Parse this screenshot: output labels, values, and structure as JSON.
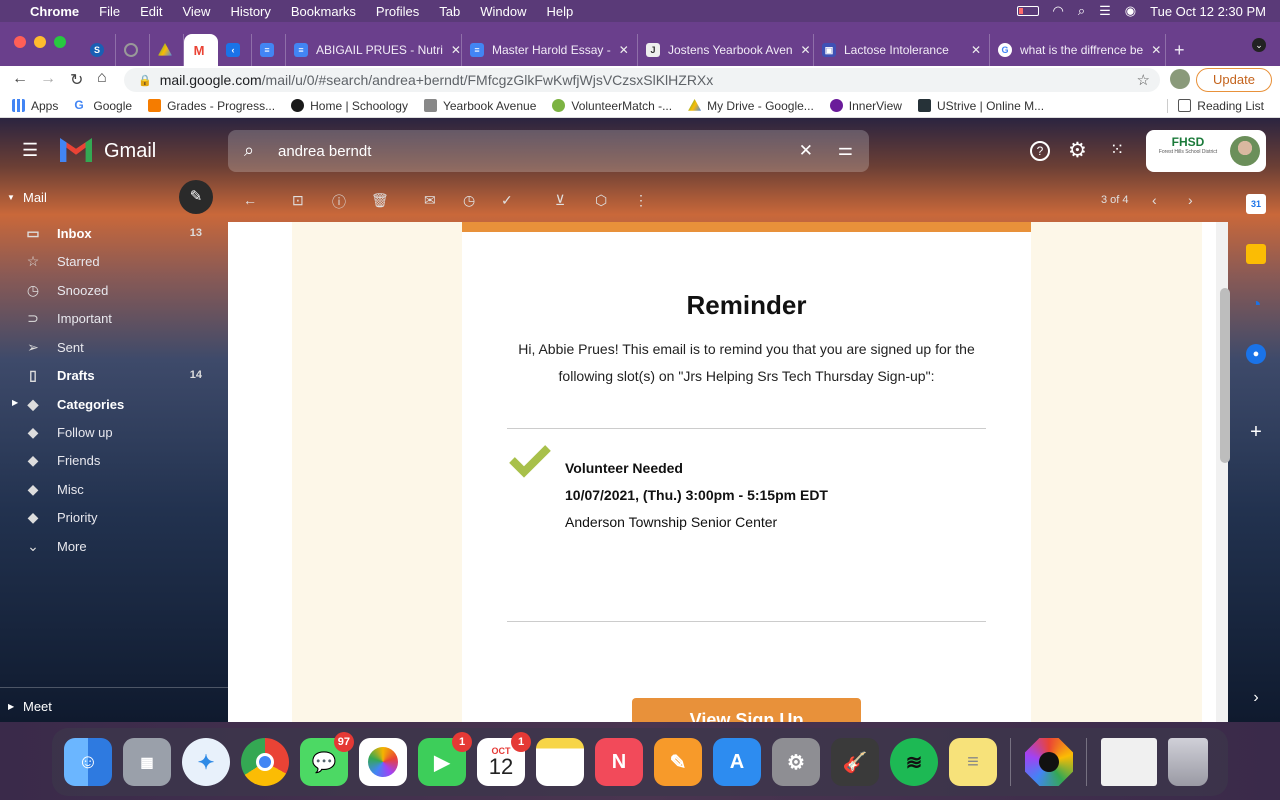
{
  "menubar": {
    "apple": "",
    "app": "Chrome",
    "items": [
      "File",
      "Edit",
      "View",
      "History",
      "Bookmarks",
      "Profiles",
      "Tab",
      "Window",
      "Help"
    ],
    "datetime": "Tue Oct 12  2:30 PM"
  },
  "tabs": [
    {
      "label": "",
      "icon": "schoology-icon",
      "color": "#1a5fb4"
    },
    {
      "label": "",
      "icon": "loading-icon",
      "color": "#888888"
    },
    {
      "label": "",
      "icon": "drive-icon",
      "color": "#34a853"
    },
    {
      "label": "",
      "icon": "gmail-icon",
      "color": "#ea4335",
      "active": true
    },
    {
      "label": "",
      "icon": "app-icon",
      "color": "#1a73e8"
    },
    {
      "label": "",
      "icon": "docs-icon",
      "color": "#4285f4"
    },
    {
      "label": "ABIGAIL PRUES - Nutri",
      "icon": "docs-icon",
      "color": "#4285f4"
    },
    {
      "label": "Master Harold Essay - ",
      "icon": "docs-icon",
      "color": "#4285f4"
    },
    {
      "label": "Jostens Yearbook Aven",
      "icon": "jostens-icon",
      "color": "#555555"
    },
    {
      "label": "Lactose Intolerance",
      "icon": "site-icon",
      "color": "#3f51b5"
    },
    {
      "label": "what is the diffrence be",
      "icon": "google-icon",
      "color": "#4285f4"
    }
  ],
  "toolbar": {
    "url_host": "mail.google.com",
    "url_path": "/mail/u/0/#search/andrea+berndt/FMfcgzGlkFwKwfjWjsVCzsxSlKlHZRXx",
    "update_label": "Update"
  },
  "bookmarks": [
    {
      "label": "Apps",
      "color": "#4285f4"
    },
    {
      "label": "Google",
      "color": "#ea4335"
    },
    {
      "label": "Grades - Progress...",
      "color": "#f57c00"
    },
    {
      "label": "Home | Schoology",
      "color": "#1a5fb4"
    },
    {
      "label": "Yearbook Avenue",
      "color": "#555555"
    },
    {
      "label": "VolunteerMatch -...",
      "color": "#7cb342"
    },
    {
      "label": "My Drive - Google...",
      "color": "#34a853"
    },
    {
      "label": "InnerView",
      "color": "#6a1b9a"
    },
    {
      "label": "UStrive | Online M...",
      "color": "#263238"
    }
  ],
  "reading_list": "Reading List",
  "gmail": {
    "logo": "Gmail",
    "search_value": "andrea berndt",
    "mail_label": "Mail",
    "nav": [
      {
        "label": "Inbox",
        "count": "13",
        "bold": true,
        "icon": "inbox-icon",
        "glyph": "▭"
      },
      {
        "label": "Starred",
        "count": "",
        "icon": "star-icon",
        "glyph": "☆"
      },
      {
        "label": "Snoozed",
        "count": "",
        "icon": "clock-icon",
        "glyph": "◷"
      },
      {
        "label": "Important",
        "count": "",
        "icon": "important-icon",
        "glyph": "⊃"
      },
      {
        "label": "Sent",
        "count": "",
        "icon": "send-icon",
        "glyph": "➢"
      },
      {
        "label": "Drafts",
        "count": "14",
        "bold": true,
        "icon": "draft-icon",
        "glyph": "▯"
      },
      {
        "label": "Categories",
        "count": "",
        "bold": true,
        "icon": "label-icon",
        "glyph": "◆"
      },
      {
        "label": "Follow up",
        "count": "",
        "icon": "label-icon",
        "glyph": "◆"
      },
      {
        "label": "Friends",
        "count": "",
        "icon": "label-icon",
        "glyph": "◆"
      },
      {
        "label": "Misc",
        "count": "",
        "icon": "label-icon",
        "glyph": "◆"
      },
      {
        "label": "Priority",
        "count": "",
        "icon": "label-icon",
        "glyph": "◆"
      },
      {
        "label": "More",
        "count": "",
        "icon": "chevron-down-icon",
        "glyph": "⌄"
      }
    ],
    "meet_label": "Meet",
    "pager": "3 of 4",
    "school_logo": "FHSD",
    "school_subtitle": "Forest Hills School District"
  },
  "email": {
    "title": "Reminder",
    "intro": "Hi, Abbie Prues! This email is to remind you that you are signed up for the following slot(s) on \"Jrs Helping Srs Tech Thursday Sign-up\":",
    "slot_title": "Volunteer Needed",
    "slot_time": "10/07/2021, (Thu.) 3:00pm - 5:15pm EDT",
    "slot_location": "Anderson Township Senior Center",
    "button": "View Sign Up"
  },
  "dock": [
    {
      "name": "finder",
      "color": "#3d8ee8",
      "badge": ""
    },
    {
      "name": "launchpad",
      "color": "#9aa0aa",
      "badge": ""
    },
    {
      "name": "safari",
      "color": "#2e8ae6",
      "badge": ""
    },
    {
      "name": "chrome",
      "color": "#e0e0e0",
      "badge": ""
    },
    {
      "name": "messages",
      "color": "#4cd964",
      "badge": "97"
    },
    {
      "name": "photos",
      "color": "#f5f5f5",
      "badge": ""
    },
    {
      "name": "facetime",
      "color": "#3dce5a",
      "badge": "1"
    },
    {
      "name": "calendar",
      "color": "#ffffff",
      "badge": "1",
      "month": "OCT",
      "day": "12"
    },
    {
      "name": "notes",
      "color": "#f5e9a8",
      "badge": ""
    },
    {
      "name": "news",
      "color": "#f24a5a",
      "badge": ""
    },
    {
      "name": "pages",
      "color": "#f79a2a",
      "badge": ""
    },
    {
      "name": "app-store",
      "color": "#2d8cf0",
      "badge": ""
    },
    {
      "name": "system-preferences",
      "color": "#8e8e93",
      "badge": ""
    },
    {
      "name": "garageband",
      "color": "#3a3a3a",
      "badge": ""
    },
    {
      "name": "spotify",
      "color": "#1db954",
      "badge": ""
    },
    {
      "name": "stickies",
      "color": "#f7e27a",
      "badge": ""
    },
    {
      "name": "screen-share",
      "color": "#e8e8e8",
      "badge": ""
    },
    {
      "name": "downloads",
      "color": "#f0f0f0",
      "badge": ""
    },
    {
      "name": "trash",
      "color": "#b0b0b8",
      "badge": ""
    }
  ]
}
